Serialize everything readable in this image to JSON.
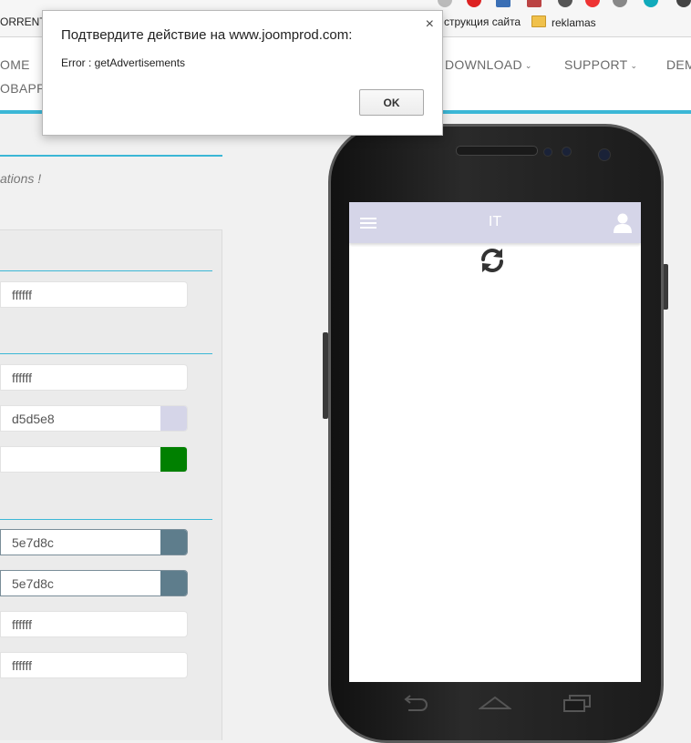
{
  "browser": {
    "bookmarks": [
      {
        "label": "ORRENTA"
      },
      {
        "label": "струкция сайта"
      },
      {
        "label": "reklamas",
        "icon": "folder-icon"
      }
    ]
  },
  "site_nav": {
    "items": [
      {
        "label": "OME"
      },
      {
        "label": "OBAPP"
      },
      {
        "label": "DOWNLOAD",
        "caret": "⌄"
      },
      {
        "label": "SUPPORT",
        "caret": "⌄"
      },
      {
        "label": "DEM"
      }
    ],
    "accent": "#3bb7d6"
  },
  "settings": {
    "tagline": "ations !",
    "fields": [
      {
        "value": "ffffff",
        "color": "#ffffff"
      },
      {
        "value": "ffffff",
        "color": "#ffffff"
      },
      {
        "value": "d5d5e8",
        "color": "#d5d5e8"
      },
      {
        "value": "",
        "color": "#008000"
      },
      {
        "value": "5e7d8c",
        "color": "#5e7d8c"
      },
      {
        "value": "5e7d8c",
        "color": "#5e7d8c"
      },
      {
        "value": "ffffff",
        "color": "#ffffff"
      },
      {
        "value": "ffffff",
        "color": "#ffffff"
      }
    ]
  },
  "phone": {
    "app_bar": {
      "title": "IT",
      "background": "#d5d5e8",
      "menu_icon": "hamburger-icon",
      "user_icon": "user-icon"
    },
    "content_icon": "refresh-icon"
  },
  "dialog": {
    "title": "Подтвердите действие на www.joomprod.com:",
    "message": "Error : getAdvertisements",
    "ok_label": "OK",
    "close_glyph": "×"
  }
}
